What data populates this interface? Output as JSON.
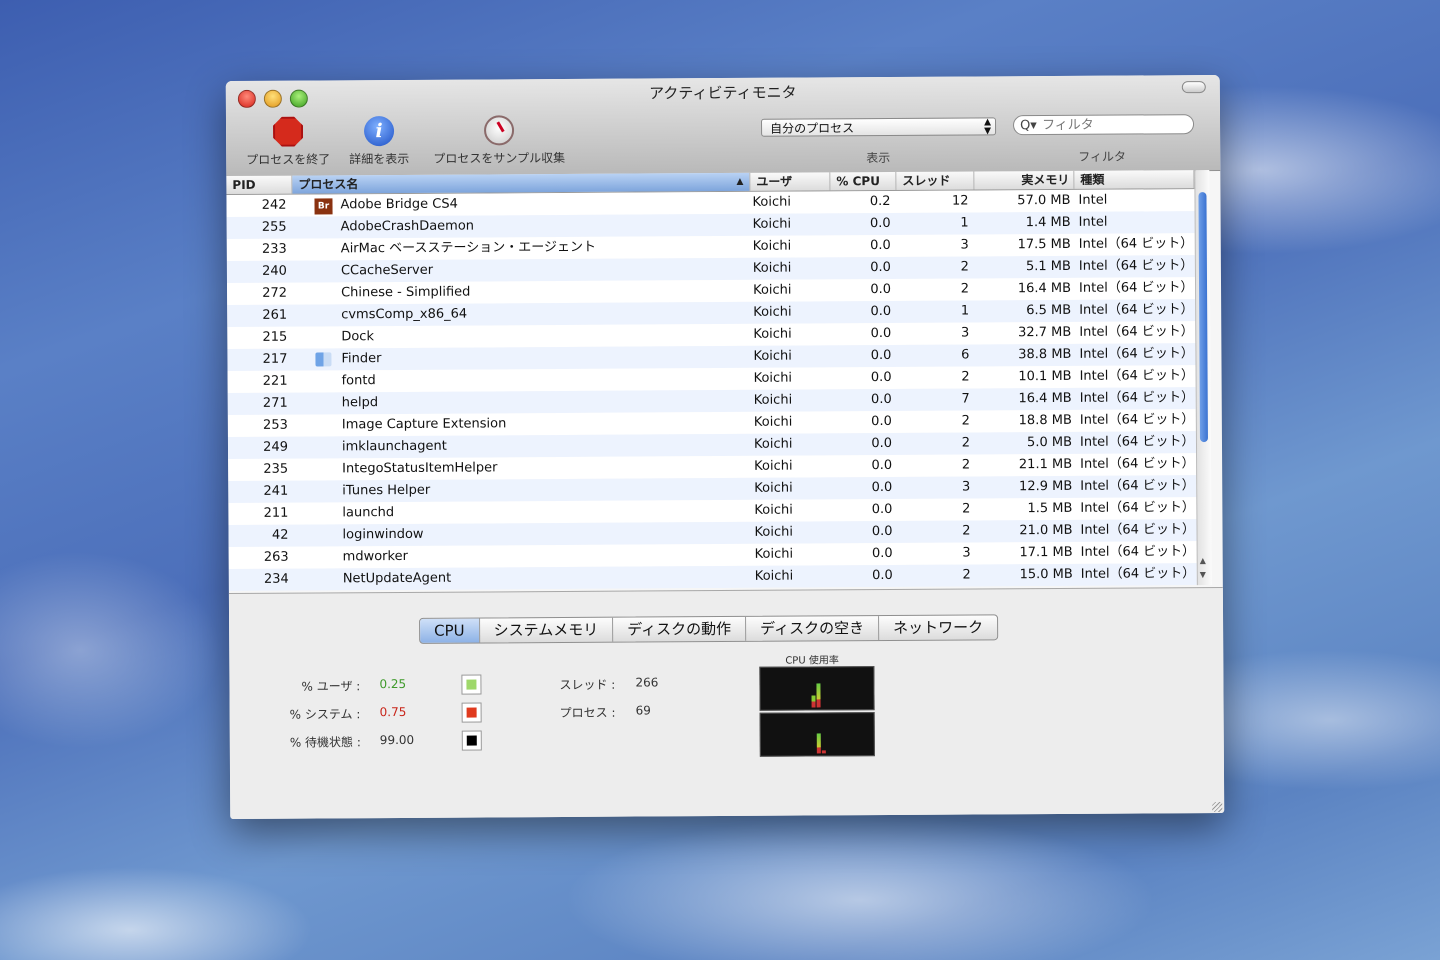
{
  "window": {
    "title": "アクティビティモニタ"
  },
  "toolbar": {
    "quit_label": "プロセスを終了",
    "info_label": "詳細を表示",
    "sample_label": "プロセスをサンプル収集",
    "show_select_value": "自分のプロセス",
    "show_label": "表示",
    "filter_placeholder": "フィルタ",
    "filter_label": "フィルタ"
  },
  "columns": {
    "pid": "PID",
    "name": "プロセス名",
    "user": "ユーザ",
    "cpu": "% CPU",
    "threads": "スレッド",
    "mem": "実メモリ",
    "kind": "種類"
  },
  "processes": [
    {
      "pid": "242",
      "name": "Adobe Bridge CS4",
      "icon": "bridge-icon",
      "user": "Koichi",
      "cpu": "0.2",
      "threads": "12",
      "mem": "57.0 MB",
      "kind": "Intel"
    },
    {
      "pid": "255",
      "name": "AdobeCrashDaemon",
      "icon": "",
      "user": "Koichi",
      "cpu": "0.0",
      "threads": "1",
      "mem": "1.4 MB",
      "kind": "Intel"
    },
    {
      "pid": "233",
      "name": "AirMac ベースステーション・エージェント",
      "icon": "",
      "user": "Koichi",
      "cpu": "0.0",
      "threads": "3",
      "mem": "17.5 MB",
      "kind": "Intel（64 ビット）"
    },
    {
      "pid": "240",
      "name": "CCacheServer",
      "icon": "",
      "user": "Koichi",
      "cpu": "0.0",
      "threads": "2",
      "mem": "5.1 MB",
      "kind": "Intel（64 ビット）"
    },
    {
      "pid": "272",
      "name": "Chinese - Simplified",
      "icon": "",
      "user": "Koichi",
      "cpu": "0.0",
      "threads": "2",
      "mem": "16.4 MB",
      "kind": "Intel（64 ビット）"
    },
    {
      "pid": "261",
      "name": "cvmsComp_x86_64",
      "icon": "",
      "user": "Koichi",
      "cpu": "0.0",
      "threads": "1",
      "mem": "6.5 MB",
      "kind": "Intel（64 ビット）"
    },
    {
      "pid": "215",
      "name": "Dock",
      "icon": "",
      "user": "Koichi",
      "cpu": "0.0",
      "threads": "3",
      "mem": "32.7 MB",
      "kind": "Intel（64 ビット）"
    },
    {
      "pid": "217",
      "name": "Finder",
      "icon": "finder-icon",
      "user": "Koichi",
      "cpu": "0.0",
      "threads": "6",
      "mem": "38.8 MB",
      "kind": "Intel（64 ビット）"
    },
    {
      "pid": "221",
      "name": "fontd",
      "icon": "",
      "user": "Koichi",
      "cpu": "0.0",
      "threads": "2",
      "mem": "10.1 MB",
      "kind": "Intel（64 ビット）"
    },
    {
      "pid": "271",
      "name": "helpd",
      "icon": "",
      "user": "Koichi",
      "cpu": "0.0",
      "threads": "7",
      "mem": "16.4 MB",
      "kind": "Intel（64 ビット）"
    },
    {
      "pid": "253",
      "name": "Image Capture Extension",
      "icon": "",
      "user": "Koichi",
      "cpu": "0.0",
      "threads": "2",
      "mem": "18.8 MB",
      "kind": "Intel（64 ビット）"
    },
    {
      "pid": "249",
      "name": "imklaunchagent",
      "icon": "",
      "user": "Koichi",
      "cpu": "0.0",
      "threads": "2",
      "mem": "5.0 MB",
      "kind": "Intel（64 ビット）"
    },
    {
      "pid": "235",
      "name": "IntegoStatusItemHelper",
      "icon": "",
      "user": "Koichi",
      "cpu": "0.0",
      "threads": "2",
      "mem": "21.1 MB",
      "kind": "Intel（64 ビット）"
    },
    {
      "pid": "241",
      "name": "iTunes Helper",
      "icon": "",
      "user": "Koichi",
      "cpu": "0.0",
      "threads": "3",
      "mem": "12.9 MB",
      "kind": "Intel（64 ビット）"
    },
    {
      "pid": "211",
      "name": "launchd",
      "icon": "",
      "user": "Koichi",
      "cpu": "0.0",
      "threads": "2",
      "mem": "1.5 MB",
      "kind": "Intel（64 ビット）"
    },
    {
      "pid": "42",
      "name": "loginwindow",
      "icon": "",
      "user": "Koichi",
      "cpu": "0.0",
      "threads": "2",
      "mem": "21.0 MB",
      "kind": "Intel（64 ビット）"
    },
    {
      "pid": "263",
      "name": "mdworker",
      "icon": "",
      "user": "Koichi",
      "cpu": "0.0",
      "threads": "3",
      "mem": "17.1 MB",
      "kind": "Intel（64 ビット）"
    },
    {
      "pid": "234",
      "name": "NetUpdateAgent",
      "icon": "",
      "user": "Koichi",
      "cpu": "0.0",
      "threads": "2",
      "mem": "15.0 MB",
      "kind": "Intel（64 ビット）"
    }
  ],
  "tabs": [
    "CPU",
    "システムメモリ",
    "ディスクの動作",
    "ディスクの空き",
    "ネットワーク"
  ],
  "cpu_stats": {
    "user_label": "% ユーザ :",
    "user_value": "0.25",
    "user_color": "#9fd86a",
    "system_label": "% システム :",
    "system_value": "0.75",
    "system_color": "#e03a1e",
    "idle_label": "% 待機状態 :",
    "idle_value": "99.00",
    "idle_color": "#000000",
    "threads_label": "スレッド :",
    "threads_value": "266",
    "processes_label": "プロセス :",
    "processes_value": "69",
    "graph_title": "CPU 使用率"
  }
}
